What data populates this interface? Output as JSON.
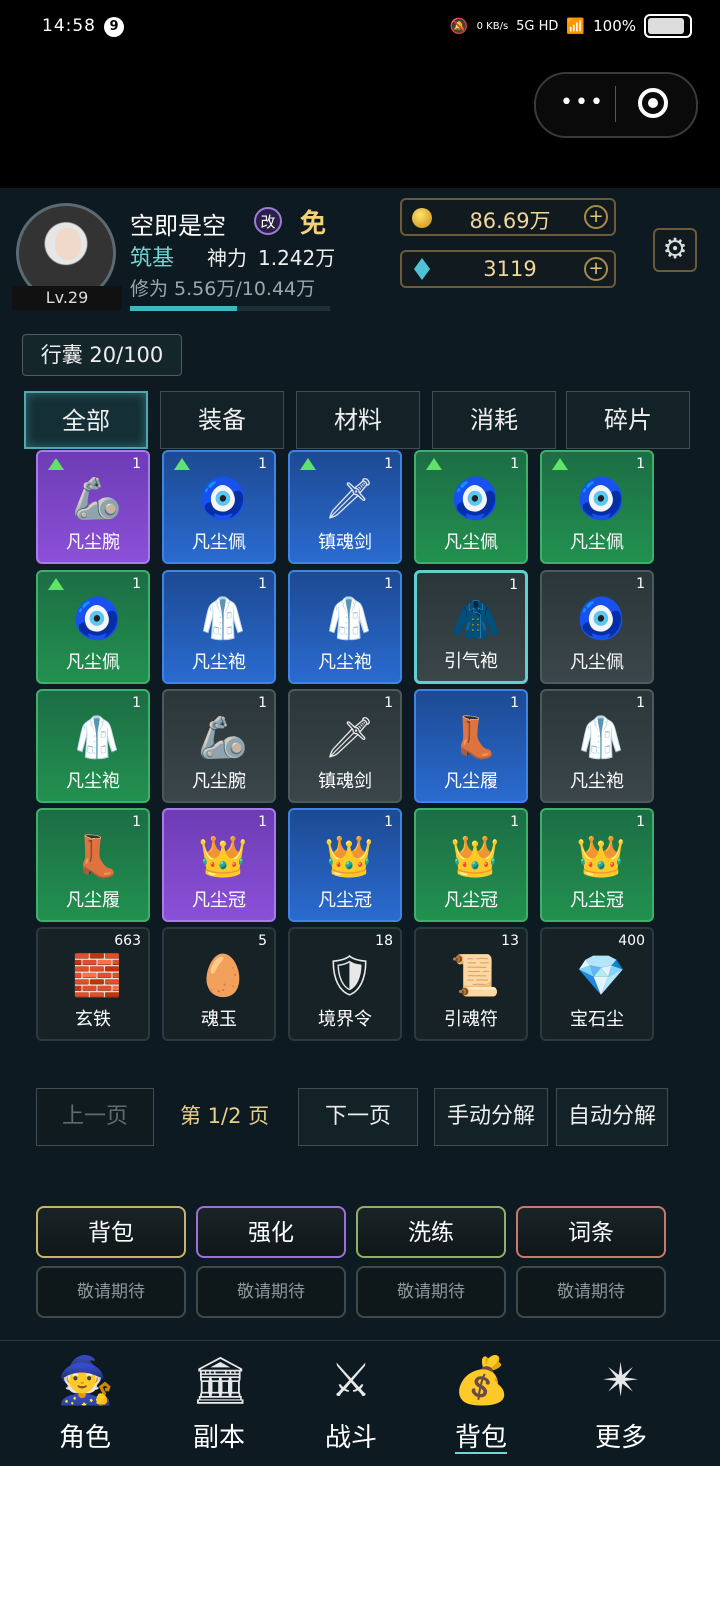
{
  "status_bar": {
    "time": "14:58",
    "notification_badge": "9",
    "net_speed": "0 KB/s",
    "network": "5G HD",
    "battery": "100%",
    "battery_level": 1.0
  },
  "player": {
    "name": "空即是空",
    "change_badge": "改",
    "free_badge": "免",
    "level": "Lv.29",
    "realm": "筑基",
    "power_label": "神力",
    "power_value": "1.242万",
    "exp_text": "修为 5.56万/10.44万",
    "exp_fraction": 0.533
  },
  "resources": {
    "gold": "86.69万",
    "jade": "3119"
  },
  "bag": {
    "capacity": "行囊 20/100"
  },
  "tabs": [
    {
      "label": "全部",
      "active": true
    },
    {
      "label": "装备",
      "active": false
    },
    {
      "label": "材料",
      "active": false
    },
    {
      "label": "消耗",
      "active": false
    },
    {
      "label": "碎片",
      "active": false
    }
  ],
  "items": [
    {
      "name": "凡尘腕",
      "count": "1",
      "quality": "purple",
      "upgrade": true,
      "icon": "bracer-icon"
    },
    {
      "name": "凡尘佩",
      "count": "1",
      "quality": "blue",
      "upgrade": true,
      "icon": "pendant-icon"
    },
    {
      "name": "镇魂剑",
      "count": "1",
      "quality": "blue",
      "upgrade": true,
      "icon": "sword-icon"
    },
    {
      "name": "凡尘佩",
      "count": "1",
      "quality": "green",
      "upgrade": true,
      "icon": "pendant-icon"
    },
    {
      "name": "凡尘佩",
      "count": "1",
      "quality": "green",
      "upgrade": true,
      "icon": "pendant-icon"
    },
    {
      "name": "凡尘佩",
      "count": "1",
      "quality": "green",
      "upgrade": true,
      "icon": "pendant-icon"
    },
    {
      "name": "凡尘袍",
      "count": "1",
      "quality": "blue",
      "upgrade": false,
      "icon": "robe-icon"
    },
    {
      "name": "凡尘袍",
      "count": "1",
      "quality": "blue",
      "upgrade": false,
      "icon": "robe-icon"
    },
    {
      "name": "引气袍",
      "count": "1",
      "quality": "grey",
      "upgrade": false,
      "icon": "red-robe-icon",
      "selected": true
    },
    {
      "name": "凡尘佩",
      "count": "1",
      "quality": "grey",
      "upgrade": false,
      "icon": "pendant-icon"
    },
    {
      "name": "凡尘袍",
      "count": "1",
      "quality": "green",
      "upgrade": false,
      "icon": "robe-icon"
    },
    {
      "name": "凡尘腕",
      "count": "1",
      "quality": "grey",
      "upgrade": false,
      "icon": "bracer-icon"
    },
    {
      "name": "镇魂剑",
      "count": "1",
      "quality": "grey",
      "upgrade": false,
      "icon": "sword-icon"
    },
    {
      "name": "凡尘履",
      "count": "1",
      "quality": "blue",
      "upgrade": false,
      "icon": "boots-icon"
    },
    {
      "name": "凡尘袍",
      "count": "1",
      "quality": "grey",
      "upgrade": false,
      "icon": "robe-icon"
    },
    {
      "name": "凡尘履",
      "count": "1",
      "quality": "green",
      "upgrade": false,
      "icon": "boots-icon"
    },
    {
      "name": "凡尘冠",
      "count": "1",
      "quality": "purple",
      "upgrade": false,
      "icon": "crown-icon"
    },
    {
      "name": "凡尘冠",
      "count": "1",
      "quality": "blue",
      "upgrade": false,
      "icon": "crown-icon"
    },
    {
      "name": "凡尘冠",
      "count": "1",
      "quality": "green",
      "upgrade": false,
      "icon": "crown-icon"
    },
    {
      "name": "凡尘冠",
      "count": "1",
      "quality": "green",
      "upgrade": false,
      "icon": "crown-icon"
    },
    {
      "name": "玄铁",
      "count": "663",
      "quality": "dark",
      "upgrade": false,
      "icon": "iron-ingot-icon"
    },
    {
      "name": "魂玉",
      "count": "5",
      "quality": "dark",
      "upgrade": false,
      "icon": "soul-jade-icon"
    },
    {
      "name": "境界令",
      "count": "18",
      "quality": "dark",
      "upgrade": false,
      "icon": "realm-token-icon"
    },
    {
      "name": "引魂符",
      "count": "13",
      "quality": "dark",
      "upgrade": false,
      "icon": "talisman-icon"
    },
    {
      "name": "宝石尘",
      "count": "400",
      "quality": "dark",
      "upgrade": false,
      "icon": "gem-dust-icon"
    }
  ],
  "paging": {
    "prev": "上一页",
    "info": "第 1/2 页",
    "next": "下一页",
    "manual_decompose": "手动分解",
    "auto_decompose": "自动分解"
  },
  "features": [
    {
      "label": "背包",
      "sub": "敬请期待",
      "color": "#c9b36a"
    },
    {
      "label": "强化",
      "sub": "敬请期待",
      "color": "#9c70d8"
    },
    {
      "label": "洗练",
      "sub": "敬请期待",
      "color": "#8fb06a"
    },
    {
      "label": "词条",
      "sub": "敬请期待",
      "color": "#c87a6a"
    }
  ],
  "nav": [
    {
      "label": "角色",
      "icon": "character-icon"
    },
    {
      "label": "副本",
      "icon": "dungeon-icon"
    },
    {
      "label": "战斗",
      "icon": "battle-icon"
    },
    {
      "label": "背包",
      "icon": "bag-icon",
      "active": true
    },
    {
      "label": "更多",
      "icon": "more-icon"
    }
  ]
}
